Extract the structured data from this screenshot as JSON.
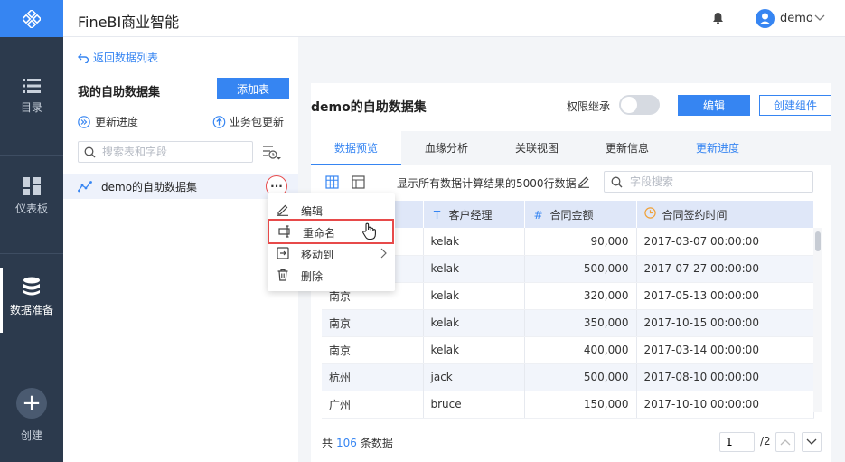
{
  "app": {
    "title": "FineBI商业智能"
  },
  "user": {
    "name": "demo"
  },
  "nav": {
    "items": [
      {
        "label": "目录",
        "icon": "list-icon"
      },
      {
        "label": "仪表板",
        "icon": "dashboard-icon"
      },
      {
        "label": "数据准备",
        "icon": "database-icon",
        "active": true
      },
      {
        "label": "创建",
        "icon": "plus-icon"
      }
    ]
  },
  "left": {
    "back_label": "返回数据列表",
    "title": "我的自助数据集",
    "add_table_label": "添加表",
    "update_progress_label": "更新进度",
    "package_update_label": "业务包更新",
    "search_placeholder": "搜索表和字段",
    "dataset_name": "demo的自助数据集",
    "more_label": "···"
  },
  "context_menu": {
    "items": [
      {
        "label": "编辑"
      },
      {
        "label": "重命名",
        "highlighted": true
      },
      {
        "label": "移动到",
        "has_submenu": true
      },
      {
        "label": "删除"
      }
    ]
  },
  "main": {
    "title": "demo的自助数据集",
    "permission_label": "权限继承",
    "permission_on": false,
    "edit_label": "编辑",
    "create_component_label": "创建组件",
    "tabs": [
      {
        "label": "数据预览",
        "active": true
      },
      {
        "label": "血缘分析"
      },
      {
        "label": "关联视图"
      },
      {
        "label": "更新信息"
      },
      {
        "label": "更新进度",
        "link": true
      }
    ],
    "note": "显示所有数据计算结果的5000行数据",
    "field_search_placeholder": "字段搜索"
  },
  "table": {
    "columns": [
      {
        "label": "",
        "type_icon": ""
      },
      {
        "label": "客户经理",
        "type_icon": "T"
      },
      {
        "label": "合同金额",
        "type_icon": "#"
      },
      {
        "label": "合同签约时间",
        "type_icon": "clock"
      }
    ],
    "rows": [
      [
        "",
        "kelak",
        "90,000",
        "2017-03-07 00:00:00"
      ],
      [
        "",
        "kelak",
        "500,000",
        "2017-07-27 00:00:00"
      ],
      [
        "南京",
        "kelak",
        "320,000",
        "2017-05-13 00:00:00"
      ],
      [
        "南京",
        "kelak",
        "350,000",
        "2017-10-15 00:00:00"
      ],
      [
        "南京",
        "kelak",
        "400,000",
        "2017-03-14 00:00:00"
      ],
      [
        "杭州",
        "jack",
        "500,000",
        "2017-08-10 00:00:00"
      ],
      [
        "广州",
        "bruce",
        "150,000",
        "2017-10-10 00:00:00"
      ]
    ]
  },
  "footer": {
    "total_prefix": "共",
    "total_count": "106",
    "total_suffix": "条数据",
    "current_page": "1",
    "page_total": "/2"
  },
  "colors": {
    "accent": "#3685f2",
    "nav_bg": "#2c3a4d",
    "highlight": "#e74a4a"
  }
}
